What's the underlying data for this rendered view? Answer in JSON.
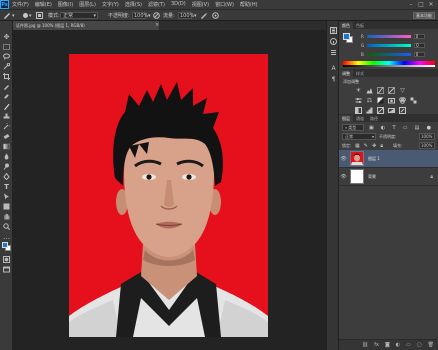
{
  "app": {
    "logo": "Ps"
  },
  "menus": [
    "文件(F)",
    "编辑(E)",
    "图像(I)",
    "图层(L)",
    "文字(Y)",
    "选择(S)",
    "滤镜(T)",
    "3D(D)",
    "视图(V)",
    "窗口(W)",
    "帮助(H)"
  ],
  "window_controls": [
    "–",
    "□",
    "✕"
  ],
  "options_bar": {
    "mode_label": "模式:",
    "mode_value": "正常",
    "opacity_label": "不透明度:",
    "opacity_value": "100%",
    "flow_label": "流量:",
    "flow_value": "100%",
    "workspace": "基本功能"
  },
  "document": {
    "tab_title": "证件照.jpg @ 100% (图层 1, RGB/8)",
    "close": "×"
  },
  "panels": {
    "color_tabs": [
      "颜色",
      "色板"
    ],
    "color_sliders": [
      {
        "label": "R",
        "value": "0"
      },
      {
        "label": "G",
        "value": "0"
      },
      {
        "label": "B",
        "value": "0"
      }
    ],
    "adjust_tabs": [
      "调整",
      "样式"
    ],
    "adjust_hint": "添加调整",
    "layers_tabs": [
      "图层",
      "通道",
      "路径"
    ],
    "kind_label": "类型",
    "blend_mode": "正常",
    "opacity_label": "不透明度:",
    "opacity_value": "100%",
    "lock_label": "锁定:",
    "fill_label": "填充:",
    "fill_value": "100%",
    "layers": [
      {
        "name": "图层 1",
        "selected": true
      },
      {
        "name": "背景",
        "selected": false
      }
    ]
  },
  "colors": {
    "photo_background": "#e5101b",
    "selected_layer": "#4a5a73",
    "accent": "#31a8ff"
  }
}
